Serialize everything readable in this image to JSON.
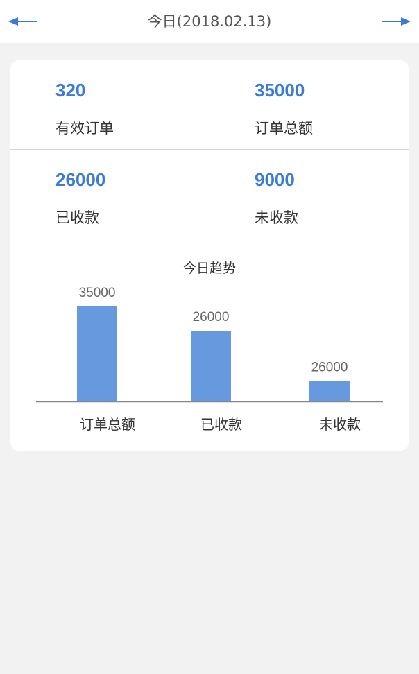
{
  "header": {
    "title": "今日(2018.02.13)",
    "prev_icon": "arrow-left-icon",
    "next_icon": "arrow-right-icon",
    "accent": "#3a7bd5"
  },
  "stats": {
    "valid_orders": {
      "value": "320",
      "label": "有效订单"
    },
    "order_total": {
      "value": "35000",
      "label": "订单总额"
    },
    "received": {
      "value": "26000",
      "label": "已收款"
    },
    "unreceived": {
      "value": "9000",
      "label": "未收款"
    }
  },
  "chart_data": {
    "type": "bar",
    "title": "今日趋势",
    "categories": [
      "订单总额",
      "已收款",
      "未收款"
    ],
    "values": [
      35000,
      26000,
      7500
    ],
    "data_labels": [
      "35000",
      "26000",
      "26000"
    ],
    "ylim": [
      0,
      35000
    ],
    "bar_color": "#6699dd"
  }
}
